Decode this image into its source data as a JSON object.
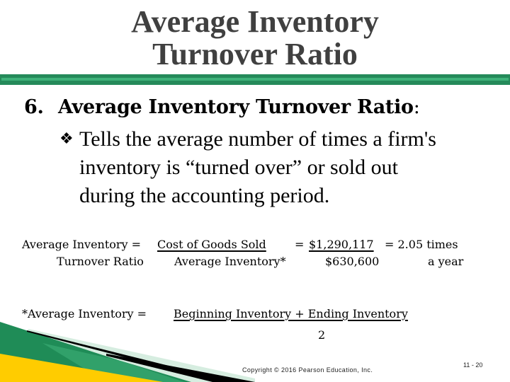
{
  "slide": {
    "title_lines": [
      "Average Inventory",
      "Turnover Ratio"
    ],
    "heading": {
      "number": "6.",
      "text": "Average Inventory Turnover Ratio",
      "colon": ":"
    },
    "bullet": {
      "glyph": "❖",
      "lines": [
        "Tells the average number of times a firm's",
        "inventory is “turned over” or sold out",
        "during the accounting period."
      ]
    },
    "formula": {
      "label_top": "Average Inventory =",
      "label_bottom": "Turnover Ratio",
      "numerator": "Cost of Goods Sold",
      "denominator": "Average Inventory*",
      "equals": "=",
      "value_numerator": "$1,290,117",
      "value_denominator": "$630,600",
      "result": "= 2.05 times",
      "result_unit": "a year"
    },
    "footnote": {
      "label": "*Average Inventory =",
      "numerator": "Beginning Inventory + Ending Inventory",
      "denominator": "2"
    },
    "footer": {
      "copyright": "Copyright © 2016 Pearson Education, Inc.",
      "page": "11 - 20"
    },
    "colors": {
      "title": "#404040",
      "rule": "#258a5a",
      "rule_highlight": "#3fb27a",
      "deco_green": "#1f8c57",
      "deco_yellow": "#ffcc00",
      "deco_light": "#d6ede0"
    }
  }
}
